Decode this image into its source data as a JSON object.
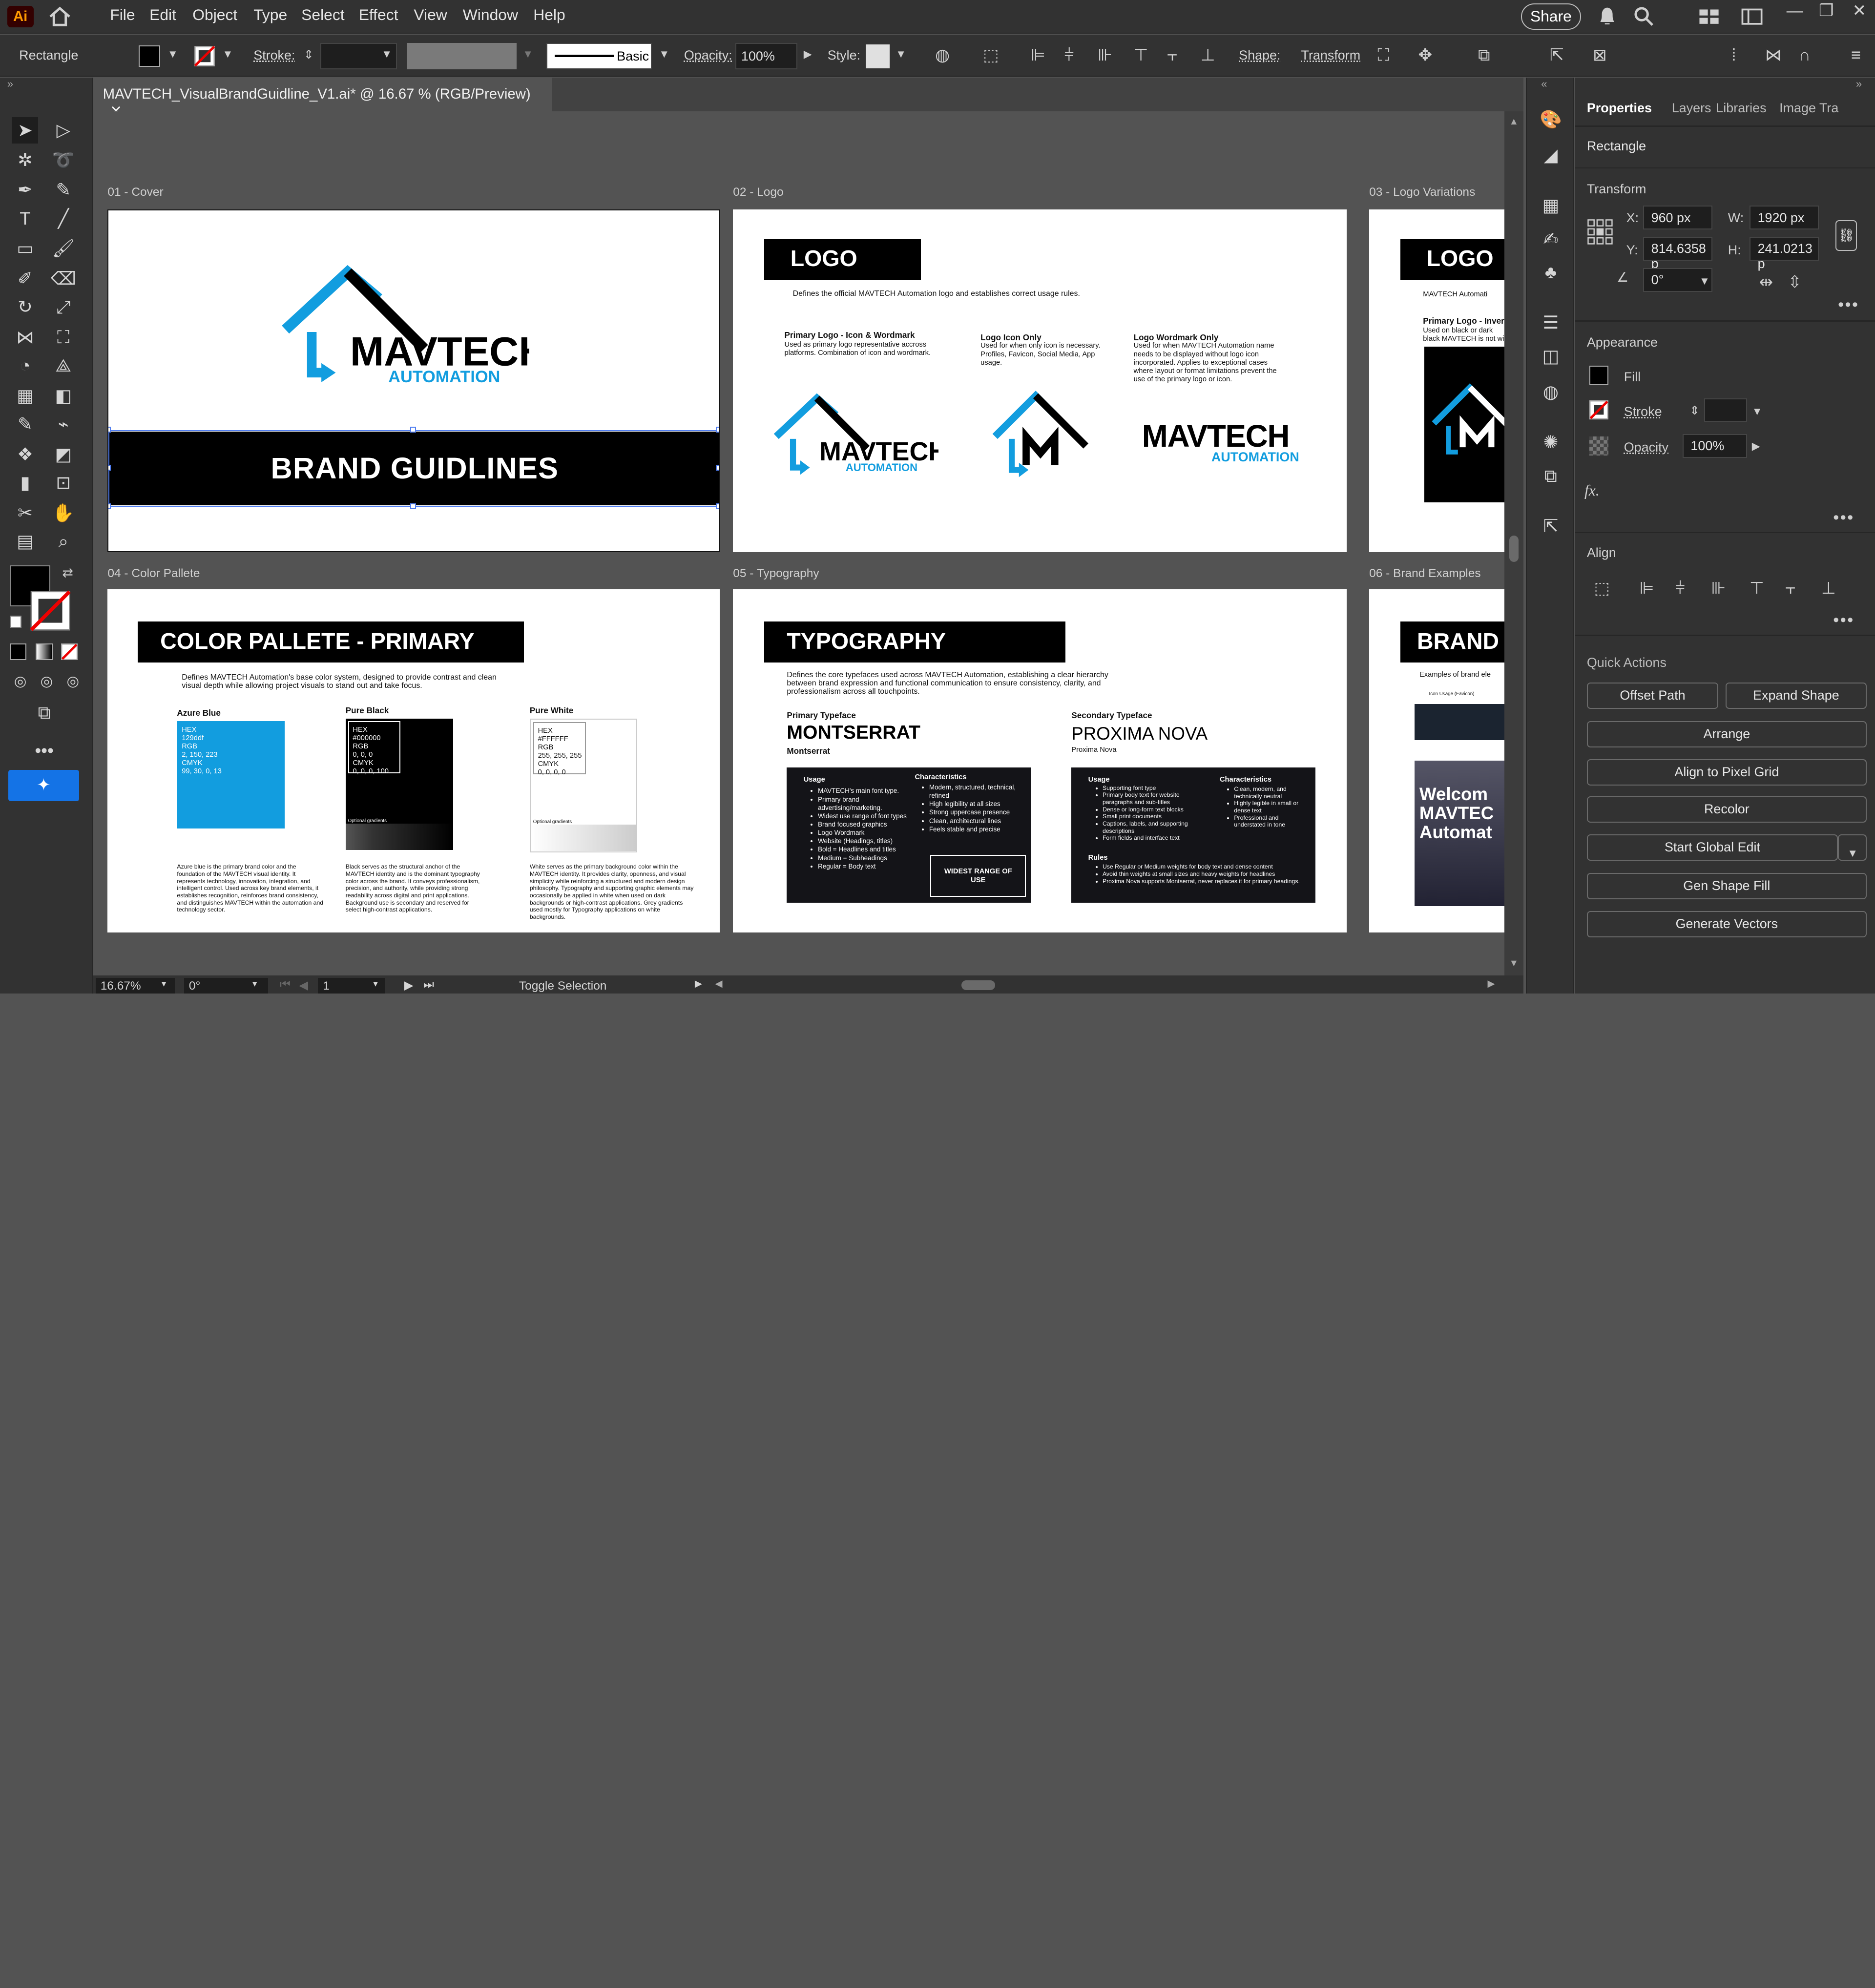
{
  "app": {
    "logo": "Ai",
    "home_icon": "home-icon"
  },
  "menu": [
    "File",
    "Edit",
    "Object",
    "Type",
    "Select",
    "Effect",
    "View",
    "Window",
    "Help"
  ],
  "header": {
    "share_label": "Share"
  },
  "control": {
    "tool_name": "Rectangle",
    "stroke_label": "Stroke:",
    "brush_label": "Basic",
    "opacity_label": "Opacity:",
    "opacity_value": "100%",
    "style_label": "Style:",
    "shape_label": "Shape:",
    "transform_label": "Transform"
  },
  "document": {
    "tab_title": "MAVTECH_VisualBrandGuidline_V1.ai* @ 16.67 % (RGB/Preview)",
    "close": "✕"
  },
  "artboards": {
    "labels": [
      "01 - Cover",
      "02 - Logo",
      "03 - Logo Variations",
      "04 - Color Pallete",
      "05 - Typography",
      "06 - Brand Examples"
    ],
    "cover": {
      "brand": "MAVTECH",
      "sub": "AUTOMATION",
      "banner": "BRAND GUIDLINES"
    },
    "logo": {
      "heading": "LOGO",
      "intro": "Defines the official MAVTECH Automation logo and establishes correct usage rules.",
      "col1_title": "Primary Logo - Icon & Wordmark",
      "col1_text": "Used as primary logo representative accross platforms. Combination of icon and wordmark.",
      "col2_title": "Logo Icon Only",
      "col2_text": "Used for when only icon is necessary. Profiles, Favicon, Social Media, App usage.",
      "col3_title": "Logo Wordmark Only",
      "col3_text": "Used for when MAVTECH Automation name needs to be displayed without logo icon incorporated. Applies to exceptional cases where layout or format limitations prevent the use of the primary logo or icon.",
      "wm_main": "MAVTECH",
      "wm_sub": "AUTOMATION"
    },
    "logovar": {
      "heading": "LOGO",
      "intro": "MAVTECH Automati",
      "sub_title": "Primary Logo - Inver",
      "sub_text": "Used on black or dark black MAVTECH is not wi"
    },
    "color": {
      "heading": "COLOR PALLETE - PRIMARY",
      "intro": "Defines MAVTECH Automation's base color system, designed to provide contrast and clean visual depth while allowing project visuals to stand out and take focus.",
      "swatches": [
        {
          "name": "Azure Blue",
          "hex": "#129ddf",
          "specs": "HEX\n129ddf\nRGB\n2, 150, 223\nCMYK\n99, 30, 0, 13",
          "desc": "Azure blue is the primary brand color and the foundation of the MAVTECH visual identity. It represents technology, innovation, integration, and intelligent control. Used across key brand elements, it establishes recognition, reinforces brand consistency, and distinguishes MAVTECH within the automation and technology sector."
        },
        {
          "name": "Pure Black",
          "hex": "#000000",
          "specs": "HEX\n#000000\nRGB\n0, 0, 0\nCMYK\n0, 0, 0, 100",
          "desc": "Black serves as the structural anchor of the MAVTECH identity and is the dominant typography color across the brand. It conveys professionalism, precision, and authority, while providing strong readability across digital and print applications. Background use is secondary and reserved for select high-contrast applications."
        },
        {
          "name": "Pure White",
          "hex": "#ffffff",
          "specs": "HEX\n#FFFFFF\nRGB\n255, 255, 255\nCMYK\n0, 0, 0, 0",
          "desc": "White serves as the primary background color within the MAVTECH identity. It provides clarity, openness, and visual simplicity while reinforcing a structured and modern design philosophy. Typography and supporting graphic elements may occasionally be applied in white when used on dark backgrounds or high-contrast applications. Grey gradients used mostly for Typography applications on white backgrounds."
        }
      ],
      "gradient_label": "Optional gradients"
    },
    "typo": {
      "heading": "TYPOGRAPHY",
      "intro": "Defines the core typefaces used across MAVTECH Automation, establishing a clear hierarchy between brand expression and functional communication to ensure consistency, clarity, and professionalism across all touchpoints.",
      "primary_label": "Primary Typeface",
      "primary_name": "MONTSERRAT",
      "primary_small": "Montserrat",
      "secondary_label": "Secondary Typeface",
      "secondary_name": "PROXIMA NOVA",
      "secondary_small": "Proxima Nova",
      "usage": "Usage",
      "characteristics": "Characteristics",
      "rules": "Rules",
      "p_usage": [
        "MAVTECH's main font type.",
        "Primary brand advertising/marketing.",
        "Widest use range of font types",
        "Brand focused graphics",
        "Logo Wordmark",
        "Website (Headings, titles)",
        "Bold = Headlines and titles",
        "Medium = Subheadings",
        "Regular = Body text"
      ],
      "p_char": [
        "Modern, structured, technical, refined",
        "High legibility at all sizes",
        "Strong uppercase presence",
        "Clean, architectural lines",
        "Feels stable and precise"
      ],
      "p_box": "WIDEST RANGE OF USE",
      "s_usage": [
        "Supporting font type",
        "Primary body text for website paragraphs and sub-titles",
        "Dense or long-form text blocks",
        "Small print documents",
        "Captions, labels, and supporting descriptions",
        "Form fields and interface text"
      ],
      "s_char": [
        "Clean, modern, and technically neutral",
        "Highly legible in small or dense text",
        "Professional and understated in tone"
      ],
      "s_rules": [
        "Use Regular or Medium weights for body text and dense content",
        "Avoid thin weights at small sizes and heavy weights for headlines",
        "Proxima Nova supports Montserrat, never replaces it for primary headings."
      ]
    },
    "brand": {
      "heading": "BRAND",
      "intro": "Examples of brand ele",
      "label1": "Icon Usage (Favicon)",
      "welcome": "Welcom MAVTEC Automat"
    }
  },
  "statusbar": {
    "zoom": "16.67%",
    "angle": "0°",
    "artboard_num": "1",
    "toggle": "Toggle Selection"
  },
  "panel": {
    "tabs": [
      "Properties",
      "Layers",
      "Libraries",
      "Image Tra"
    ],
    "object": "Rectangle",
    "transform": "Transform",
    "x_label": "X:",
    "x": "960 px",
    "y_label": "Y:",
    "y": "814.6358 p",
    "w_label": "W:",
    "w": "1920 px",
    "h_label": "H:",
    "h": "241.0213 p",
    "angle": "0°",
    "appearance": "Appearance",
    "fill": "Fill",
    "stroke": "Stroke",
    "opacity": "Opacity",
    "opacity_value": "100%",
    "fx": "fx.",
    "align": "Align",
    "quick_actions": "Quick Actions",
    "buttons": {
      "offset": "Offset Path",
      "expand": "Expand Shape",
      "arrange": "Arrange",
      "pixel": "Align to Pixel Grid",
      "recolor": "Recolor",
      "global": "Start Global Edit",
      "genfill": "Gen Shape Fill",
      "vectors": "Generate Vectors"
    }
  }
}
